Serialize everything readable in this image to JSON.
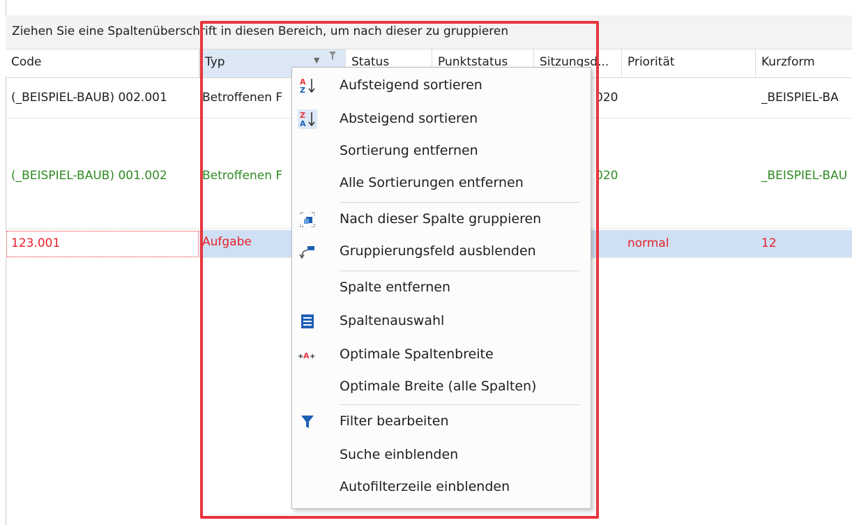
{
  "group_panel": {
    "hint": "Ziehen Sie eine Spaltenüberschrift in diesen Bereich, um nach dieser zu gruppieren"
  },
  "columns": [
    {
      "label": "Code"
    },
    {
      "label": "Typ"
    },
    {
      "label": "Status"
    },
    {
      "label": "Punktstatus"
    },
    {
      "label": "Sitzungsd..."
    },
    {
      "label": "Priorität"
    },
    {
      "label": "Kurzform"
    }
  ],
  "rows": [
    {
      "code": "(_BEISPIEL-BAUB) 002.001",
      "typ": "Betroffenen F",
      "sitzung_fragment": "020",
      "prioritaet": "",
      "kurzform": "_BEISPIEL-BA"
    },
    {
      "code": "(_BEISPIEL-BAUB) 001.002",
      "typ": "Betroffenen F",
      "sitzung_fragment": "020",
      "prioritaet": "",
      "kurzform": "_BEISPIEL-BAU"
    },
    {
      "code": "123.001",
      "typ": "Aufgabe",
      "sitzung_fragment": "",
      "prioritaet": "normal",
      "kurzform": "12"
    }
  ],
  "context_menu": {
    "items": [
      {
        "label": "Aufsteigend sortieren",
        "icon": "sort-ascending-icon"
      },
      {
        "label": "Absteigend sortieren",
        "icon": "sort-descending-icon"
      },
      {
        "label": "Sortierung entfernen",
        "icon": ""
      },
      {
        "label": "Alle Sortierungen entfernen",
        "icon": ""
      },
      {
        "label": "Nach dieser Spalte gruppieren",
        "icon": "group-by-column-icon"
      },
      {
        "label": "Gruppierungsfeld ausblenden",
        "icon": "hide-group-panel-icon"
      },
      {
        "label": "Spalte entfernen",
        "icon": ""
      },
      {
        "label": "Spaltenauswahl",
        "icon": "column-chooser-icon"
      },
      {
        "label": "Optimale Spaltenbreite",
        "icon": "best-fit-icon"
      },
      {
        "label": "Optimale Breite (alle Spalten)",
        "icon": ""
      },
      {
        "label": "Filter bearbeiten",
        "icon": "filter-icon"
      },
      {
        "label": "Suche einblenden",
        "icon": ""
      },
      {
        "label": "Autofilterzeile einblenden",
        "icon": ""
      }
    ]
  },
  "colors": {
    "accent_blue": "#1e5fb4",
    "highlight_red": "#e8363d",
    "row_green": "#2e8b22",
    "row_red": "#e8202a",
    "selected_row": "#cfe0f4"
  }
}
